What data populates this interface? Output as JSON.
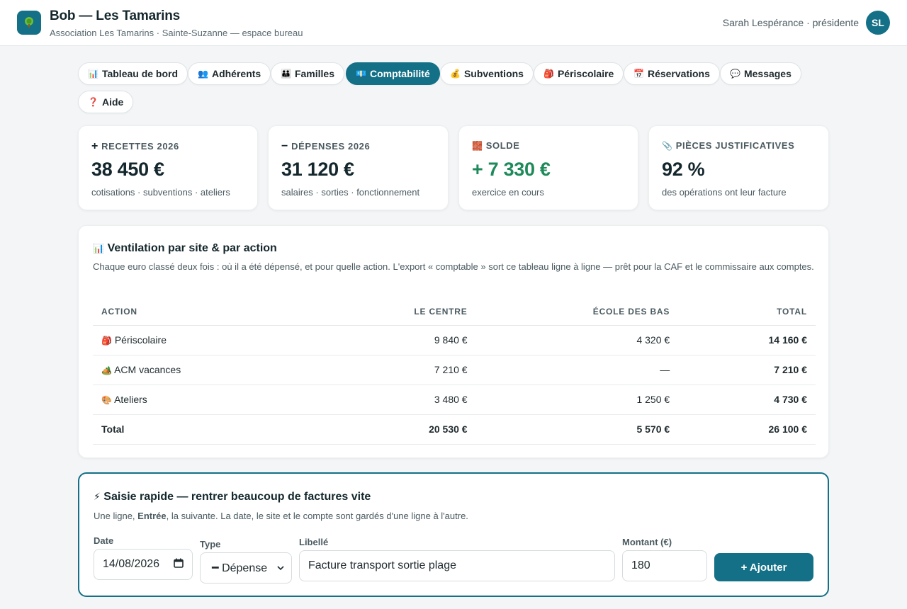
{
  "header": {
    "title": "Bob — Les Tamarins",
    "subtitle": "Association Les Tamarins · Sainte-Suzanne — espace bureau",
    "user": "Sarah Lespérance · présidente",
    "avatar_initials": "SL",
    "logo_icon": "tree-icon"
  },
  "tabs": [
    {
      "icon": "📊",
      "label": "Tableau de bord"
    },
    {
      "icon": "👥",
      "label": "Adhérents"
    },
    {
      "icon": "👪",
      "label": "Familles"
    },
    {
      "icon": "💶",
      "label": "Comptabilité",
      "active": true
    },
    {
      "icon": "💰",
      "label": "Subventions"
    },
    {
      "icon": "🎒",
      "label": "Périscolaire"
    },
    {
      "icon": "📅",
      "label": "Réservations"
    },
    {
      "icon": "💬",
      "label": "Messages"
    },
    {
      "icon": "❓",
      "label": "Aide"
    }
  ],
  "stats": [
    {
      "icon": "+",
      "label": "Recettes 2026",
      "value": "38 450 €",
      "note": "cotisations · subventions · ateliers"
    },
    {
      "icon": "−",
      "label": "Dépenses 2026",
      "value": "31 120 €",
      "note": "salaires · sorties · fonctionnement"
    },
    {
      "icon": "🧱",
      "label": "Solde",
      "value": "+ 7 330 €",
      "note": "exercice en cours"
    },
    {
      "icon": "📎",
      "label": "Pièces justificatives",
      "value": "92 %",
      "note": "des opérations ont leur facture"
    }
  ],
  "ventilation": {
    "icon": "📊",
    "title": "Ventilation par site & par action",
    "description": "Chaque euro classé deux fois : où il a été dépensé, et pour quelle action. L'export « comptable » sort ce tableau ligne à ligne — prêt pour la CAF et le commissaire aux comptes.",
    "columns": [
      "Action",
      "Le Centre",
      "École des Bas",
      "Total"
    ],
    "rows": [
      {
        "icon": "🎒",
        "action": "Périscolaire",
        "centre": "9 840 €",
        "ecole": "4 320 €",
        "total": "14 160 €"
      },
      {
        "icon": "🏕️",
        "action": "ACM vacances",
        "centre": "7 210 €",
        "ecole": "—",
        "total": "7 210 €"
      },
      {
        "icon": "🎨",
        "action": "Ateliers",
        "centre": "3 480 €",
        "ecole": "1 250 €",
        "total": "4 730 €"
      }
    ],
    "total_row": {
      "action": "Total",
      "centre": "20 530 €",
      "ecole": "5 570 €",
      "total": "26 100 €"
    }
  },
  "quick_entry": {
    "icon": "⚡",
    "title": "Saisie rapide — rentrer beaucoup de factures vite",
    "desc_before": "Une ligne, ",
    "desc_key": "Entrée",
    "desc_after": ", la suivante. La date, le site et le compte sont gardés d'une ligne à l'autre.",
    "date_label": "Date",
    "date_value": "14/08/2026",
    "type_label": "Type",
    "type_value": "━ Dépense",
    "libelle_label": "Libellé",
    "libelle_value": "Facture transport sortie plage",
    "montant_label": "Montant (€)",
    "montant_value": "180",
    "add_label": "+ Ajouter"
  }
}
